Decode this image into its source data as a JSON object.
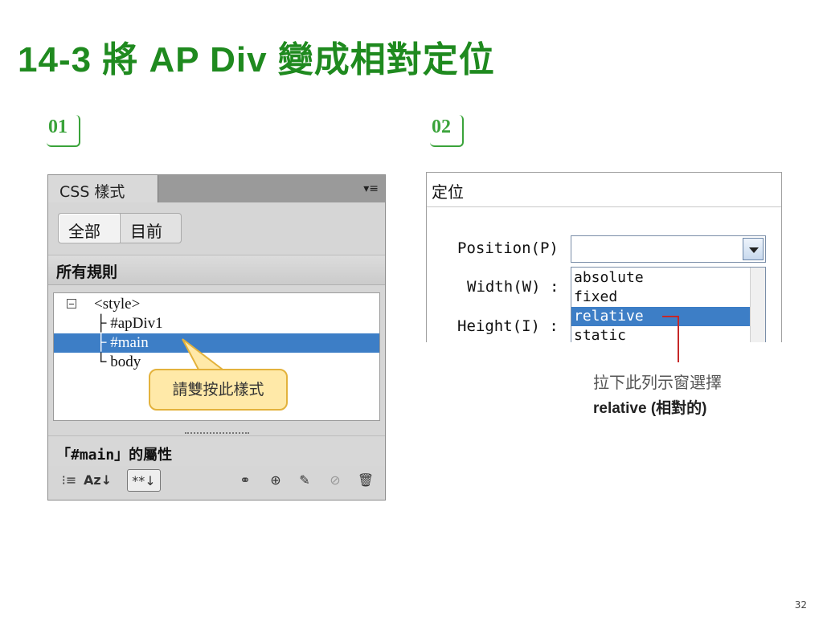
{
  "slide": {
    "title": "14-3 將 AP Div 變成相對定位",
    "step1": "01",
    "step2": "02",
    "page_number": "32"
  },
  "css_panel": {
    "tab_label": "CSS 樣式",
    "menu_icon": "panel-menu-icon",
    "seg_all": "全部",
    "seg_current": "目前",
    "rules_header": "所有規則",
    "tree": [
      "<style>",
      "├ #apDiv1",
      "├ #main",
      "└ body"
    ],
    "selected_rule": "#main",
    "callout": "請雙按此樣式",
    "props_header": "「#main」的屬性",
    "toolbar_icons": [
      "show-category-view-icon",
      "show-list-view-icon",
      "show-set-properties-icon",
      "attach-stylesheet-icon",
      "new-css-rule-icon",
      "edit-rule-icon",
      "disable-property-icon",
      "delete-rule-icon"
    ]
  },
  "positioning_panel": {
    "header": "定位",
    "position_label": "Position(P)",
    "width_label": "Width(W) :",
    "height_label": "Height(I) :",
    "position_value": "",
    "options": [
      "absolute",
      "fixed",
      "relative",
      "static"
    ],
    "selected_option": "relative"
  },
  "annotation": {
    "line1": "拉下此列示窗選擇",
    "line2": "relative (相對的)",
    "accent_color": "#c62828"
  }
}
